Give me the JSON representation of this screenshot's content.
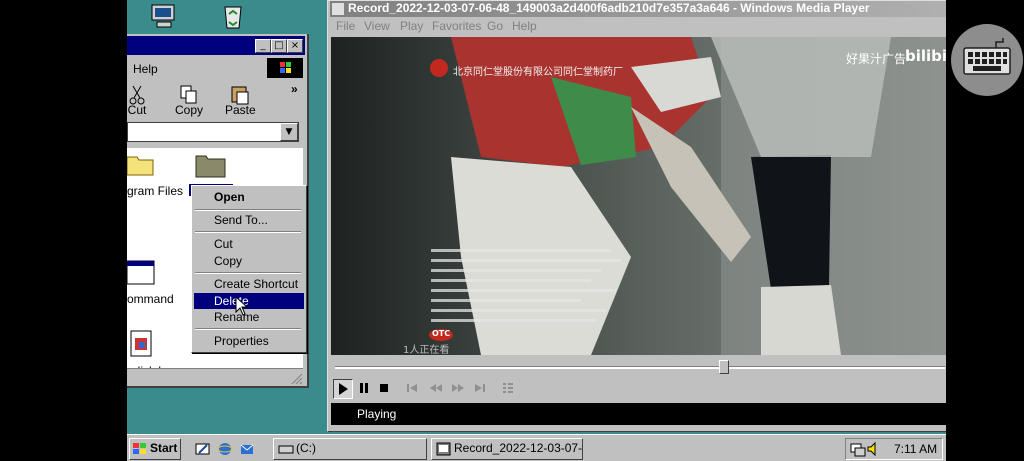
{
  "explorer": {
    "menu_help": "Help",
    "toolbar": {
      "cut": "Cut",
      "copy": "Copy",
      "paste": "Paste",
      "more": "»"
    },
    "files": [
      {
        "label": "gram Files"
      },
      {
        "label": ""
      },
      {
        "label": "ommand"
      },
      {
        "label": "ndisk.log"
      }
    ]
  },
  "context_menu": {
    "items": [
      "Open",
      "Send To...",
      "Cut",
      "Copy",
      "Create Shortcut",
      "Delete",
      "Rename",
      "Properties"
    ],
    "highlighted": "Delete"
  },
  "media_player": {
    "title": "Record_2022-12-03-07-06-48_149003a2d400f6adb210d7e357a3a646 - Windows Media Player",
    "menu": [
      "File",
      "View",
      "Play",
      "Favorites",
      "Go",
      "Help"
    ],
    "status": "Playing",
    "video": {
      "watermark": "好果汁广告",
      "brand": "bilibili",
      "viewers": "1人正在看",
      "otc": "OTC",
      "company": "北京同仁堂股份有限公司同仁堂制药厂"
    },
    "progress": 0.64
  },
  "taskbar": {
    "start": "Start",
    "tasks": [
      "(C:)",
      "Record_2022-12-03-07-06-..."
    ],
    "clock": "7:11 AM"
  },
  "colors": {
    "desktop": "#3a8c8c",
    "titlebar_active": "#00007f",
    "highlight": "#00007f",
    "face": "#c0c0c0"
  }
}
